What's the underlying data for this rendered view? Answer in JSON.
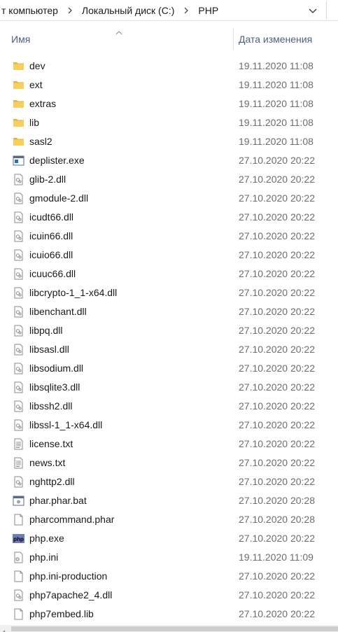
{
  "address": {
    "crumbs": [
      "т компьютер",
      "Локальный диск (C:)",
      "PHP"
    ]
  },
  "columns": {
    "name": "Имя",
    "date": "Дата изменения"
  },
  "files": [
    {
      "name": "dev",
      "date": "19.11.2020 11:08",
      "icon": "folder-icon"
    },
    {
      "name": "ext",
      "date": "19.11.2020 11:08",
      "icon": "folder-icon"
    },
    {
      "name": "extras",
      "date": "19.11.2020 11:08",
      "icon": "folder-icon"
    },
    {
      "name": "lib",
      "date": "19.11.2020 11:08",
      "icon": "folder-icon"
    },
    {
      "name": "sasl2",
      "date": "19.11.2020 11:08",
      "icon": "folder-icon"
    },
    {
      "name": "deplister.exe",
      "date": "27.10.2020 20:22",
      "icon": "exe-icon"
    },
    {
      "name": "glib-2.dll",
      "date": "27.10.2020 20:22",
      "icon": "dll-icon"
    },
    {
      "name": "gmodule-2.dll",
      "date": "27.10.2020 20:22",
      "icon": "dll-icon"
    },
    {
      "name": "icudt66.dll",
      "date": "27.10.2020 20:22",
      "icon": "dll-icon"
    },
    {
      "name": "icuin66.dll",
      "date": "27.10.2020 20:22",
      "icon": "dll-icon"
    },
    {
      "name": "icuio66.dll",
      "date": "27.10.2020 20:22",
      "icon": "dll-icon"
    },
    {
      "name": "icuuc66.dll",
      "date": "27.10.2020 20:22",
      "icon": "dll-icon"
    },
    {
      "name": "libcrypto-1_1-x64.dll",
      "date": "27.10.2020 20:22",
      "icon": "dll-icon"
    },
    {
      "name": "libenchant.dll",
      "date": "27.10.2020 20:22",
      "icon": "dll-icon"
    },
    {
      "name": "libpq.dll",
      "date": "27.10.2020 20:22",
      "icon": "dll-icon"
    },
    {
      "name": "libsasl.dll",
      "date": "27.10.2020 20:22",
      "icon": "dll-icon"
    },
    {
      "name": "libsodium.dll",
      "date": "27.10.2020 20:22",
      "icon": "dll-icon"
    },
    {
      "name": "libsqlite3.dll",
      "date": "27.10.2020 20:22",
      "icon": "dll-icon"
    },
    {
      "name": "libssh2.dll",
      "date": "27.10.2020 20:22",
      "icon": "dll-icon"
    },
    {
      "name": "libssl-1_1-x64.dll",
      "date": "27.10.2020 20:22",
      "icon": "dll-icon"
    },
    {
      "name": "license.txt",
      "date": "27.10.2020 20:22",
      "icon": "text-file-icon"
    },
    {
      "name": "news.txt",
      "date": "27.10.2020 20:22",
      "icon": "text-file-icon"
    },
    {
      "name": "nghttp2.dll",
      "date": "27.10.2020 20:22",
      "icon": "dll-icon"
    },
    {
      "name": "phar.phar.bat",
      "date": "27.10.2020 20:28",
      "icon": "batch-file-icon"
    },
    {
      "name": "pharcommand.phar",
      "date": "27.10.2020 20:28",
      "icon": "blank-file-icon"
    },
    {
      "name": "php.exe",
      "date": "27.10.2020 20:22",
      "icon": "php-exe-icon"
    },
    {
      "name": "php.ini",
      "date": "19.11.2020 11:09",
      "icon": "ini-file-icon"
    },
    {
      "name": "php.ini-production",
      "date": "27.10.2020 20:22",
      "icon": "blank-file-icon"
    },
    {
      "name": "php7apache2_4.dll",
      "date": "27.10.2020 20:22",
      "icon": "dll-icon"
    },
    {
      "name": "php7embed.lib",
      "date": "27.10.2020 20:22",
      "icon": "blank-file-icon"
    }
  ],
  "colors": {
    "folder": "#e8b33d",
    "header_text": "#4d6082",
    "date_text": "#6d6d6d"
  }
}
